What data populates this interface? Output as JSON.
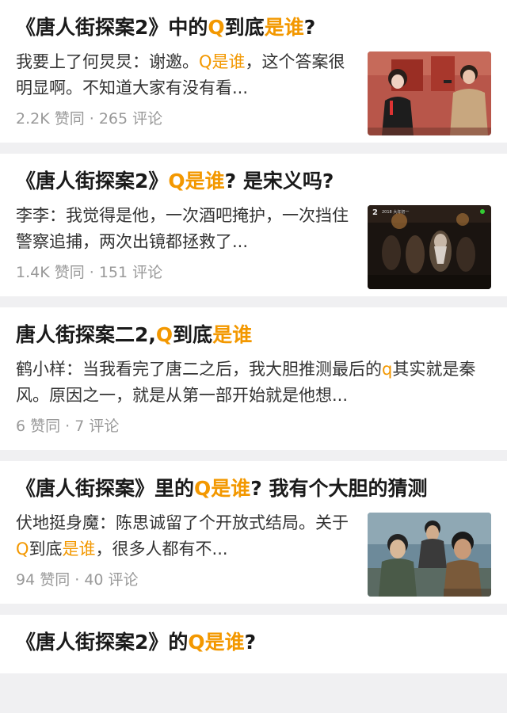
{
  "highlight_color": "#f39800",
  "cards": [
    {
      "title_parts": [
        "《唐人街探案2》中的",
        "Q",
        "到底",
        "是谁",
        "?"
      ],
      "excerpt_parts": [
        "我要上了何炅炅：谢邀。",
        "Q是谁",
        "，这个答案很明显啊。不知道大家有没有看..."
      ],
      "upvotes": "2.2K 赞同",
      "comments": "265 评论",
      "thumb_desc": "people-at-event-photo"
    },
    {
      "title_parts": [
        "《唐人街探案2》",
        "Q是谁",
        "? 是宋义吗?"
      ],
      "excerpt_parts": [
        "李李：我觉得是他，一次酒吧掩护，一次挡住警察追捕，两次出镜都拯救了..."
      ],
      "upvotes": "1.4K 赞同",
      "comments": "151 评论",
      "thumb_desc": "bar-scene-still"
    },
    {
      "title_parts": [
        "唐人街探案二2,",
        "Q",
        "到底",
        "是谁"
      ],
      "excerpt_parts": [
        "鹤小样：当我看完了唐二之后，我大胆推测最后的",
        "q",
        "其实就是秦风。原因之一，就是从第一部开始就是他想..."
      ],
      "upvotes": "6 赞同",
      "comments": "7 评论"
    },
    {
      "title_parts": [
        "《唐人街探案》里的",
        "Q是谁",
        "? 我有个大胆的猜测"
      ],
      "excerpt_parts": [
        "伏地挺身魔：陈思诚留了个开放式结局。关于",
        "Q",
        "到底",
        "是谁",
        "，很多人都有不..."
      ],
      "upvotes": "94 赞同",
      "comments": "40 评论",
      "thumb_desc": "movie-poster-still"
    },
    {
      "title_parts": [
        "《唐人街探案2》的",
        "Q是谁",
        "?"
      ]
    }
  ],
  "meta_separator": " · ",
  "thumb_overlay_text": {
    "card2_logo": "2",
    "card2_caption": "2018 大年初一"
  }
}
